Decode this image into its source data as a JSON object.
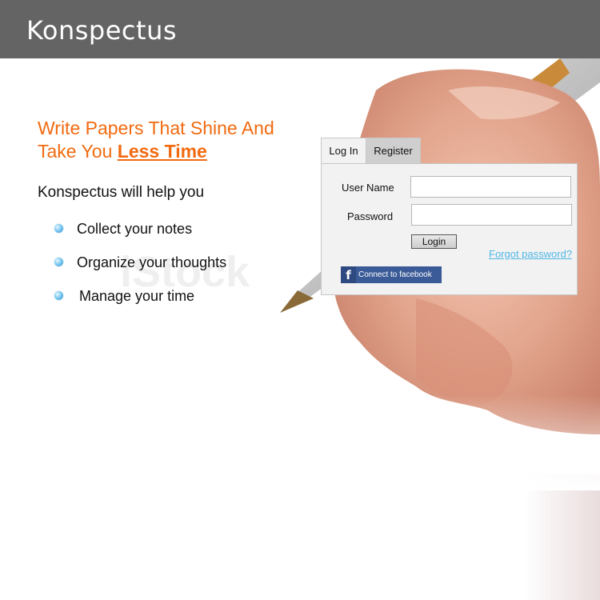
{
  "header": {
    "title": "Konspectus"
  },
  "hero": {
    "headline_part1": "Write Papers That Shine And Take You ",
    "headline_emphasis": "Less Time",
    "subhead": "Konspectus will help you",
    "features": [
      {
        "text": "Collect your notes"
      },
      {
        "text": "Organize your thoughts"
      },
      {
        "text": "Manage your time"
      }
    ]
  },
  "login": {
    "tabs": {
      "login": "Log In",
      "register": "Register"
    },
    "username_label": "User Name",
    "username_value": "",
    "password_label": "Password",
    "password_value": "",
    "submit_label": "Login",
    "forgot_label": "Forgot password?",
    "facebook_label": "Connect to facebook",
    "facebook_icon": "facebook-f-icon"
  },
  "colors": {
    "header_bg": "#646464",
    "accent_orange": "#f26a10",
    "link_blue": "#4fb7e6",
    "facebook_blue": "#3b5b98"
  }
}
